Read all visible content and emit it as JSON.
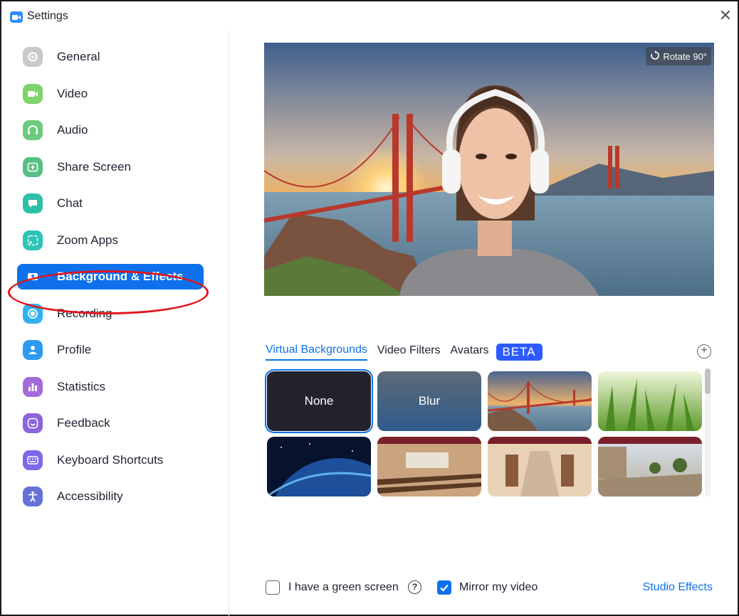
{
  "window": {
    "title": "Settings",
    "close_glyph": "✕"
  },
  "sidebar": {
    "items": [
      {
        "label": "General",
        "icon": "gear-icon",
        "color": "#c9c9c9"
      },
      {
        "label": "Video",
        "icon": "video-camera-icon",
        "color": "#7ED36B"
      },
      {
        "label": "Audio",
        "icon": "headphones-icon",
        "color": "#6BCB7C"
      },
      {
        "label": "Share Screen",
        "icon": "share-screen-icon",
        "color": "#58BF86"
      },
      {
        "label": "Chat",
        "icon": "chat-bubble-icon",
        "color": "#2DBFA8"
      },
      {
        "label": "Zoom Apps",
        "icon": "apps-icon",
        "color": "#2DC3B5"
      },
      {
        "label": "Background & Effects",
        "icon": "background-icon",
        "color": "#0E71EB"
      },
      {
        "label": "Recording",
        "icon": "record-icon",
        "color": "#2EB3F2"
      },
      {
        "label": "Profile",
        "icon": "profile-icon",
        "color": "#2C9BEF"
      },
      {
        "label": "Statistics",
        "icon": "statistics-icon",
        "color": "#A36BD9"
      },
      {
        "label": "Feedback",
        "icon": "feedback-smile-icon",
        "color": "#8C64DE"
      },
      {
        "label": "Keyboard Shortcuts",
        "icon": "keyboard-icon",
        "color": "#7A6AE6"
      },
      {
        "label": "Accessibility",
        "icon": "accessibility-icon",
        "color": "#6472D8"
      }
    ],
    "active_index": 6
  },
  "preview": {
    "rotate_label": "Rotate 90°"
  },
  "tabs": [
    {
      "label": "Virtual Backgrounds",
      "active": true
    },
    {
      "label": "Video Filters",
      "active": false
    },
    {
      "label": "Avatars",
      "active": false
    }
  ],
  "beta_badge": "BETA",
  "add_glyph": "+",
  "backgrounds": [
    {
      "label": "None",
      "kind": "none",
      "selected": true
    },
    {
      "label": "Blur",
      "kind": "blur",
      "selected": false
    },
    {
      "label": "",
      "kind": "golden-gate",
      "selected": false
    },
    {
      "label": "",
      "kind": "grass",
      "selected": false
    },
    {
      "label": "",
      "kind": "earth-space",
      "selected": false
    },
    {
      "label": "",
      "kind": "lecture-hall",
      "selected": false
    },
    {
      "label": "",
      "kind": "hallway",
      "selected": false
    },
    {
      "label": "",
      "kind": "courtyard",
      "selected": false
    }
  ],
  "footer": {
    "green_screen_label": "I have a green screen",
    "green_screen_checked": false,
    "help_glyph": "?",
    "mirror_label": "Mirror my video",
    "mirror_checked": true,
    "studio_effects_label": "Studio Effects"
  },
  "colors": {
    "accent": "#0E71EB",
    "annotation_circle": "#e0141e"
  }
}
